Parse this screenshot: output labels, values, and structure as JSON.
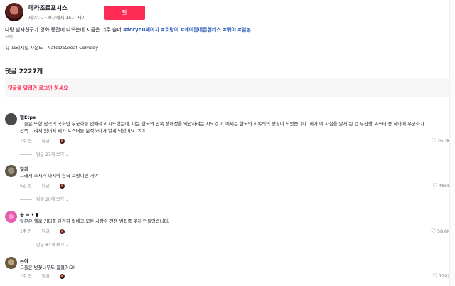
{
  "author": {
    "name": "메라조르포시스",
    "sub": "제이♡7 · 9시에서 15시 사이",
    "follow_label": "팔"
  },
  "caption": {
    "text": "나랑 남자친구가 영화 중간에 나오는데 지금은 너무 슬퍼",
    "tags": [
      "#foryou페이지",
      "#호랑이",
      "#케이팝데몬헌터스",
      "#워야",
      "#일본"
    ],
    "more_label": "보기"
  },
  "sound": {
    "icon": "music-note-icon",
    "label": "오리지널 사운드 - NateDaGreat Comedy"
  },
  "comments_count": "댓글 2227개",
  "login_prompt": "댓글을 달려면 로그인 하세요",
  "comments": [
    {
      "user": "멀Etps",
      "text": "그들은 또한 한국의 국화인 무궁화를 없애려고 시도했는데, 이는 한국의 민족 정체성을 억압하려는 시도였고, 이제는 한국의 회복력의 상징이 되었습니다. 제가 이 사실을 알게 된 건 부산행 포스터 중 하나에 무궁화가 잔뜩 그려져 있어서 제가 포스터를 분석하다가 알게 되었어요. ㅎㅎ",
      "time": "1주 전",
      "reply": "답글",
      "likes": "26.3K",
      "replies": "답글 27개 보기"
    },
    {
      "user": "딜리",
      "text": "그래서 호시가 마지막 한국 호랑이인 거야",
      "time": "6일 전",
      "reply": "답글",
      "likes": "4856",
      "replies": "답글 20개 보기"
    },
    {
      "user": "공 ∞ • ▮",
      "text": "일본은 헬로 키티를 완전히 없애고 모든 사람이 전쟁 범죄를 잊게 만들었습니다.",
      "time": "1주 전",
      "reply": "답글",
      "likes": "58.6K",
      "replies": "답글 84개 보기"
    },
    {
      "user": "논아",
      "text": "그들은 벚꽃나무도 훔쳤어요!",
      "time": "1주 전",
      "reply": "답글",
      "likes": "7292",
      "replies": ""
    }
  ],
  "colors": {
    "accent": "#fe2c55",
    "hashtag": "#2b5db9",
    "muted": "#8a8b91"
  }
}
